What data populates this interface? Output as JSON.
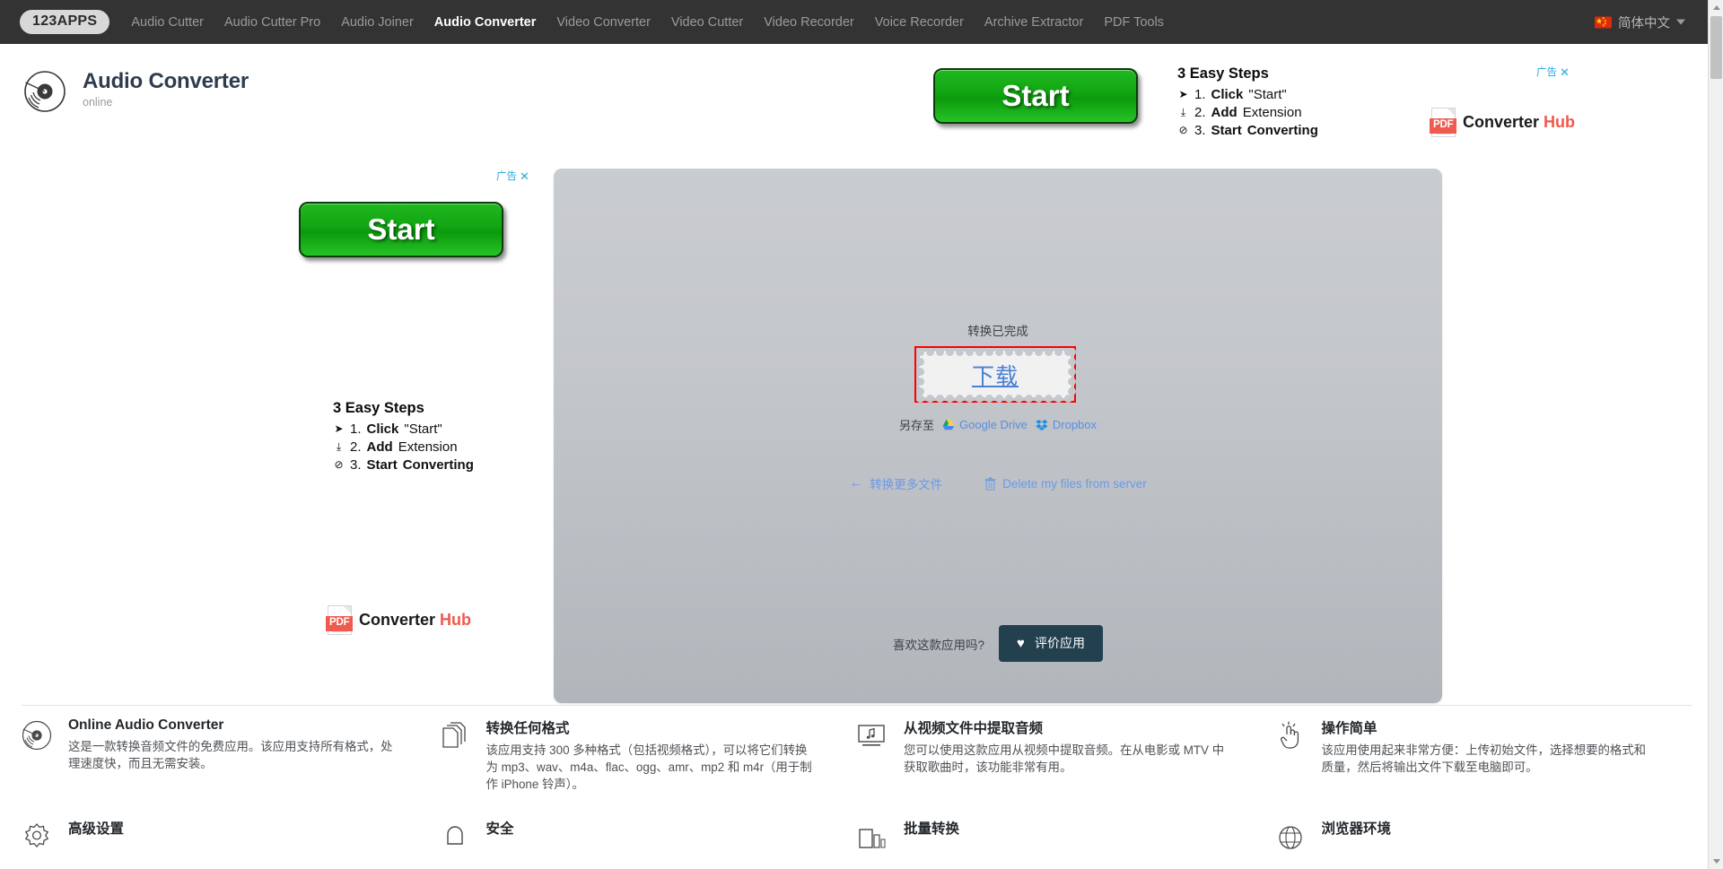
{
  "nav": {
    "brand": "123APPS",
    "items": [
      {
        "label": "Audio Cutter",
        "active": false
      },
      {
        "label": "Audio Cutter Pro",
        "active": false
      },
      {
        "label": "Audio Joiner",
        "active": false
      },
      {
        "label": "Audio Converter",
        "active": true
      },
      {
        "label": "Video Converter",
        "active": false
      },
      {
        "label": "Video Cutter",
        "active": false
      },
      {
        "label": "Video Recorder",
        "active": false
      },
      {
        "label": "Voice Recorder",
        "active": false
      },
      {
        "label": "Archive Extractor",
        "active": false
      },
      {
        "label": "PDF Tools",
        "active": false
      }
    ],
    "language": "简体中文"
  },
  "header": {
    "title": "Audio Converter",
    "subtitle": "online"
  },
  "ads": {
    "label": "广告",
    "close": "✕",
    "start_button": "Start",
    "steps_title": "3 Easy Steps",
    "steps": [
      {
        "icon": "cursor-arrow",
        "num": "1.",
        "bold": "Click",
        "rest": "\"Start\""
      },
      {
        "icon": "download-arrow",
        "num": "2.",
        "bold": "Add",
        "rest": "Extension"
      },
      {
        "icon": "check-circle",
        "num": "3.",
        "bold": "Start",
        "rest": "Converting",
        "rest_bold": true
      }
    ],
    "pdf_badge": "PDF",
    "pdf_name": "Converter",
    "pdf_name_accent": "Hub"
  },
  "panel": {
    "status": "转换已完成",
    "download_label": "下载",
    "save_to_label": "另存至",
    "google_drive": "Google Drive",
    "dropbox": "Dropbox",
    "convert_more": "转换更多文件",
    "delete_files": "Delete my files from server",
    "rate_question": "喜欢这款应用吗?",
    "rate_button": "评价应用"
  },
  "features": [
    {
      "icon": "vinyl-record-icon",
      "title": "Online Audio Converter",
      "body": "这是一款转换音频文件的免费应用。该应用支持所有格式，处理速度快，而且无需安装。"
    },
    {
      "icon": "documents-stack-icon",
      "title": "转换任何格式",
      "body": "该应用支持 300 多种格式（包括视频格式），可以将它们转换为 mp3、wav、m4a、flac、ogg、amr、mp2 和 m4r（用于制作 iPhone 铃声）。"
    },
    {
      "icon": "monitor-music-icon",
      "title": "从视频文件中提取音频",
      "body": "您可以使用这款应用从视频中提取音频。在从电影或 MTV 中获取歌曲时，该功能非常有用。"
    },
    {
      "icon": "tap-hand-icon",
      "title": "操作简单",
      "body": "该应用使用起来非常方便：上传初始文件，选择想要的格式和质量，然后将输出文件下载至电脑即可。"
    },
    {
      "icon": "gear-icon",
      "title": "高级设置",
      "body": ""
    },
    {
      "icon": "shield-icon",
      "title": "安全",
      "body": ""
    },
    {
      "icon": "batch-files-icon",
      "title": "批量转换",
      "body": ""
    },
    {
      "icon": "globe-icon",
      "title": "浏览器环境",
      "body": ""
    }
  ],
  "colors": {
    "nav_bg": "#333333",
    "accent_green": "#12a512",
    "link_blue": "#5b8ede",
    "highlight_red": "#ff0000",
    "rate_btn_bg": "#23404f",
    "pdf_red": "#f05b4f"
  }
}
